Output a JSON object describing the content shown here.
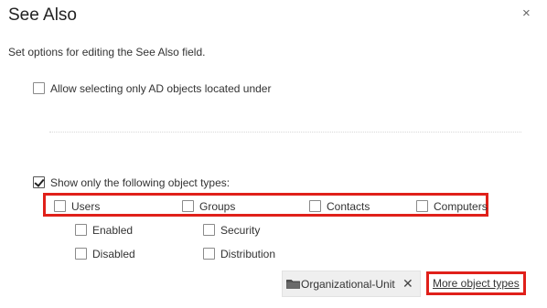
{
  "dialog": {
    "title": "See Also",
    "close_glyph": "×",
    "description": "Set options for editing the See Also field."
  },
  "options": {
    "allow_selecting_label": "Allow selecting only AD objects located under",
    "allow_selecting_checked": false,
    "show_only_label": "Show only the following object types:",
    "show_only_checked": true
  },
  "object_types": [
    {
      "label": "Users",
      "checked": false
    },
    {
      "label": "Groups",
      "checked": false
    },
    {
      "label": "Contacts",
      "checked": false
    },
    {
      "label": "Computers",
      "checked": false
    }
  ],
  "user_sub": [
    {
      "label": "Enabled",
      "checked": false
    },
    {
      "label": "Disabled",
      "checked": false
    }
  ],
  "group_sub": [
    {
      "label": "Security",
      "checked": false
    },
    {
      "label": "Distribution",
      "checked": false
    }
  ],
  "selected_types": {
    "chip_label": "Organizational-Unit",
    "chip_icon": "folder-icon",
    "remove_glyph": "✕"
  },
  "more_link": "More object types",
  "colors": {
    "highlight": "#e0201a",
    "chip_bg": "#efefef"
  }
}
